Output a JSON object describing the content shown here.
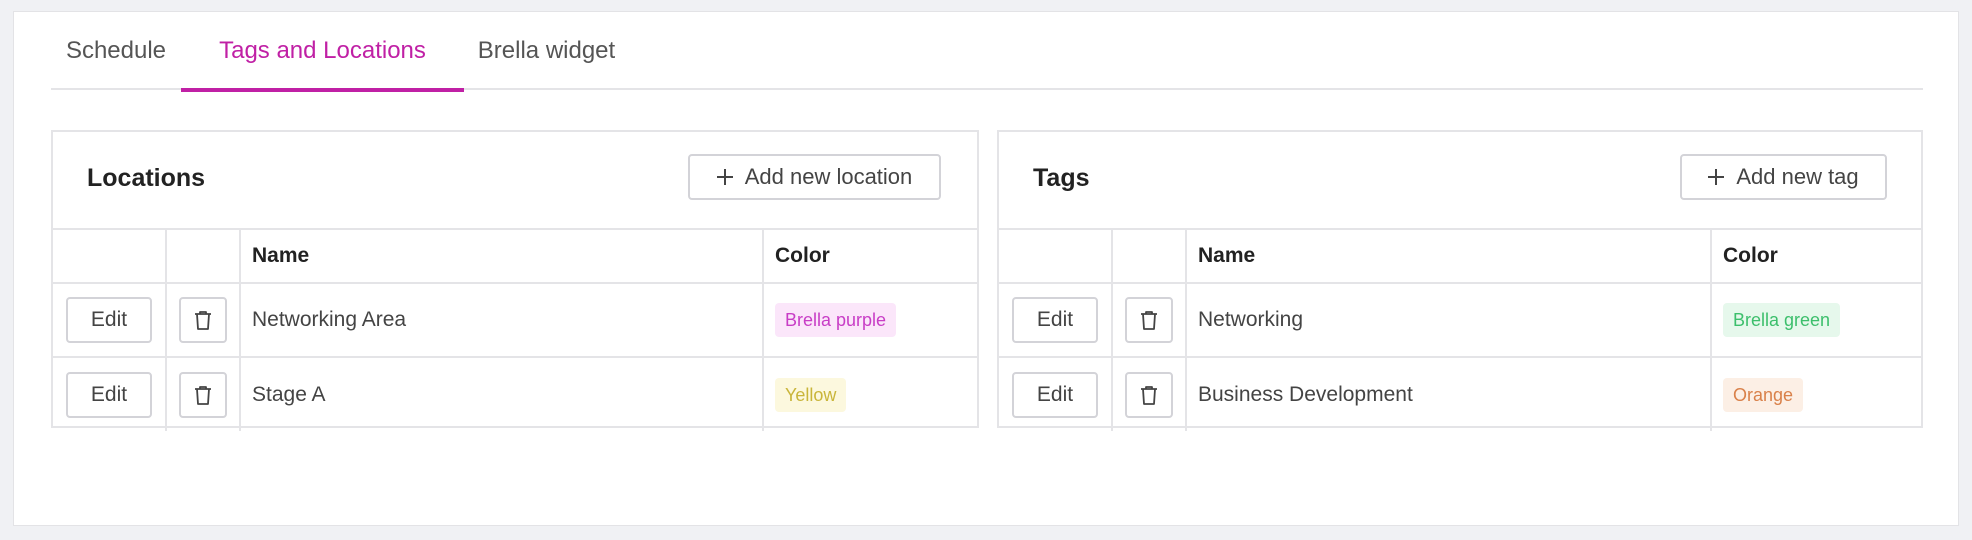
{
  "tabs": [
    {
      "label": "Schedule"
    },
    {
      "label": "Tags and Locations"
    },
    {
      "label": "Brella widget"
    }
  ],
  "locations": {
    "title": "Locations",
    "add_label": "Add new location",
    "headers": {
      "name": "Name",
      "color": "Color"
    },
    "rows": [
      {
        "edit": "Edit",
        "name": "Networking Area",
        "color": "Brella purple"
      },
      {
        "edit": "Edit",
        "name": "Stage A",
        "color": "Yellow"
      }
    ]
  },
  "tags": {
    "title": "Tags",
    "add_label": "Add new tag",
    "headers": {
      "name": "Name",
      "color": "Color"
    },
    "rows": [
      {
        "edit": "Edit",
        "name": "Networking",
        "color": "Brella green"
      },
      {
        "edit": "Edit",
        "name": "Business Development",
        "color": "Orange"
      }
    ]
  },
  "colors": {
    "accent": "#c020a5",
    "badge_purple_text": "#c83dc6",
    "badge_purple_bg": "#fbe6fa",
    "badge_yellow_text": "#c9b53a",
    "badge_yellow_bg": "#fcf8de",
    "badge_green_text": "#3cbf6c",
    "badge_green_bg": "#e6f8ec",
    "badge_orange_text": "#d9814a",
    "badge_orange_bg": "#fcefe5"
  }
}
